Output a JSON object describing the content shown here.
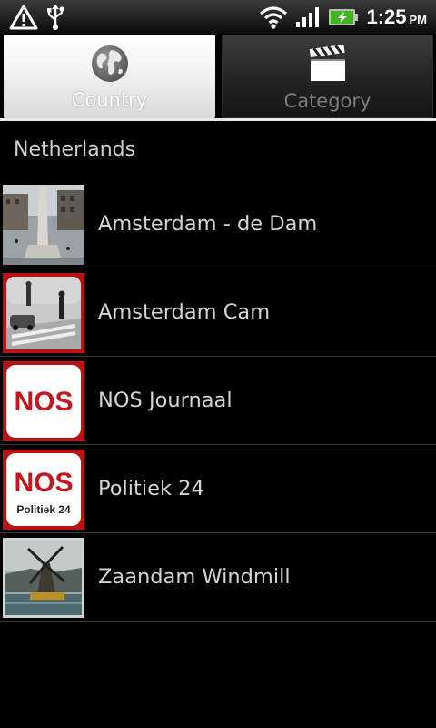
{
  "status_bar": {
    "time": "1:25",
    "ampm": "PM",
    "icons": [
      "warning-icon",
      "usb-icon",
      "wifi-icon",
      "signal-icon",
      "battery-charging-icon"
    ]
  },
  "tabs": [
    {
      "label": "Country",
      "icon": "globe-icon",
      "selected": true
    },
    {
      "label": "Category",
      "icon": "clapperboard-icon",
      "selected": false
    }
  ],
  "section_header": "Netherlands",
  "items": [
    {
      "label": "Amsterdam - de Dam",
      "thumb": "dam-square-thumbnail"
    },
    {
      "label": "Amsterdam Cam",
      "thumb": "street-cam-thumbnail"
    },
    {
      "label": "NOS Journaal",
      "thumb": "nos-logo-thumbnail"
    },
    {
      "label": "Politiek 24",
      "thumb": "nos-politiek-logo-thumbnail"
    },
    {
      "label": "Zaandam Windmill",
      "thumb": "windmill-thumbnail"
    }
  ],
  "colors": {
    "background": "#000000",
    "nos_red": "#c4161c",
    "thumb_frame_red": "#b81414"
  }
}
